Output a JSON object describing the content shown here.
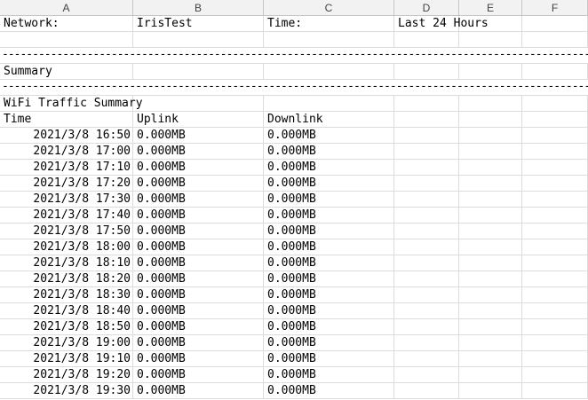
{
  "columns": [
    "A",
    "B",
    "C",
    "D",
    "E",
    "F"
  ],
  "info": {
    "network_label": "Network:",
    "network_value": "IrisTest",
    "time_label": "Time:",
    "time_value": "Last 24 Hours"
  },
  "separator": "--------------------------------------------------------------------------------------------------------------------------------------------",
  "summary_label": "Summary",
  "section_title": "WiFi Traffic Summary",
  "table": {
    "headers": [
      "Time",
      "Uplink",
      "Downlink"
    ],
    "rows": [
      [
        "2021/3/8 16:50",
        "0.000MB",
        "0.000MB"
      ],
      [
        "2021/3/8 17:00",
        "0.000MB",
        "0.000MB"
      ],
      [
        "2021/3/8 17:10",
        "0.000MB",
        "0.000MB"
      ],
      [
        "2021/3/8 17:20",
        "0.000MB",
        "0.000MB"
      ],
      [
        "2021/3/8 17:30",
        "0.000MB",
        "0.000MB"
      ],
      [
        "2021/3/8 17:40",
        "0.000MB",
        "0.000MB"
      ],
      [
        "2021/3/8 17:50",
        "0.000MB",
        "0.000MB"
      ],
      [
        "2021/3/8 18:00",
        "0.000MB",
        "0.000MB"
      ],
      [
        "2021/3/8 18:10",
        "0.000MB",
        "0.000MB"
      ],
      [
        "2021/3/8 18:20",
        "0.000MB",
        "0.000MB"
      ],
      [
        "2021/3/8 18:30",
        "0.000MB",
        "0.000MB"
      ],
      [
        "2021/3/8 18:40",
        "0.000MB",
        "0.000MB"
      ],
      [
        "2021/3/8 18:50",
        "0.000MB",
        "0.000MB"
      ],
      [
        "2021/3/8 19:00",
        "0.000MB",
        "0.000MB"
      ],
      [
        "2021/3/8 19:10",
        "0.000MB",
        "0.000MB"
      ],
      [
        "2021/3/8 19:20",
        "0.000MB",
        "0.000MB"
      ],
      [
        "2021/3/8 19:30",
        "0.000MB",
        "0.000MB"
      ]
    ]
  }
}
